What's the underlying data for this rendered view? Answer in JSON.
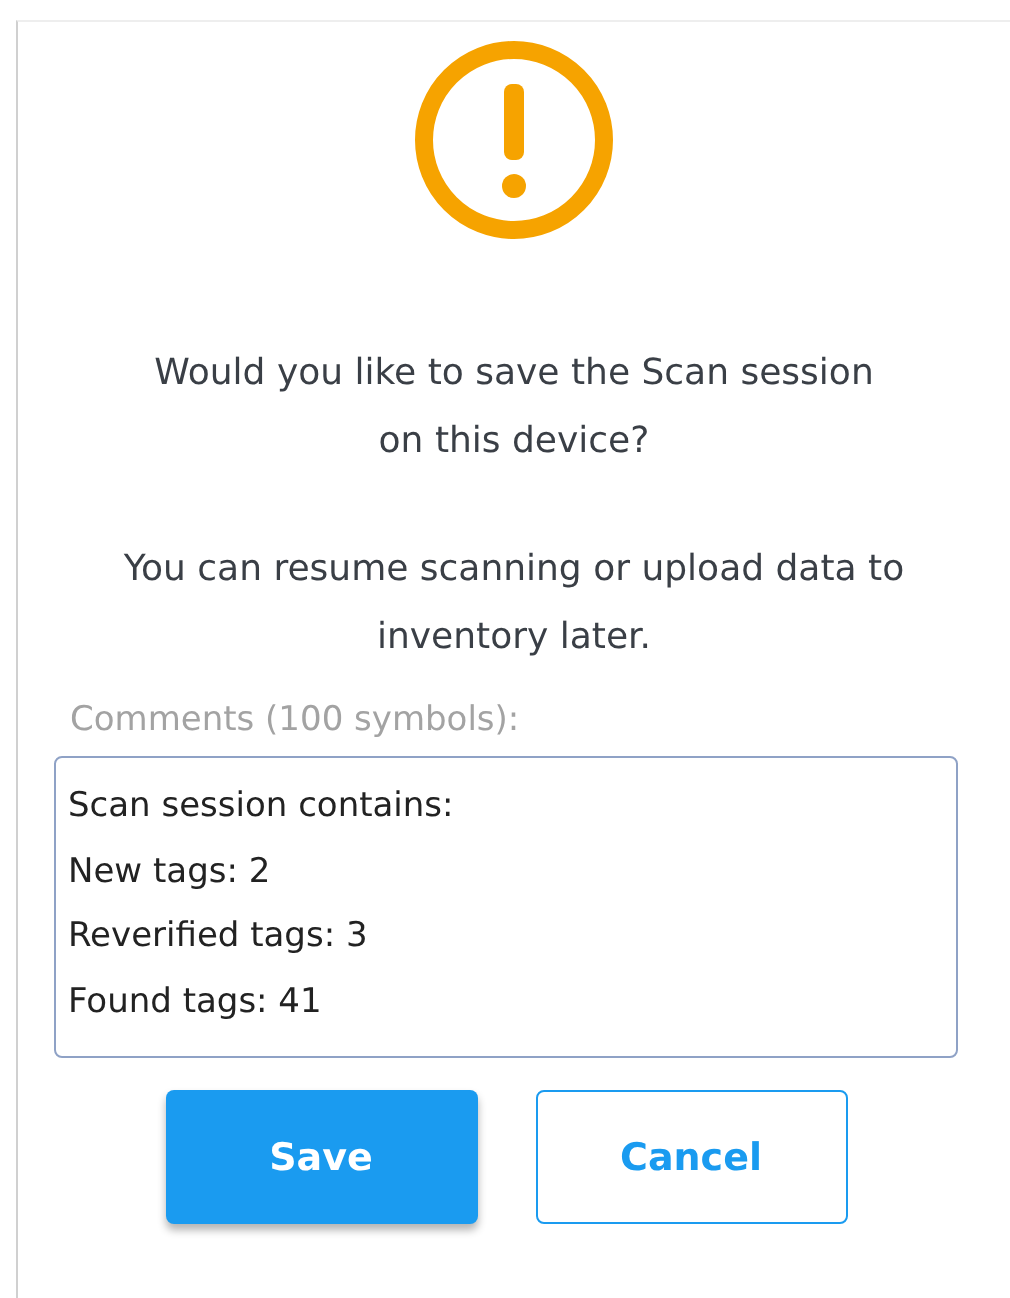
{
  "dialog": {
    "message": "Would you like to save the Scan session on this device?",
    "note": "You can resume scanning or upload data to inventory later.",
    "comments": {
      "label": "Comments (100 symbols):",
      "value": "Scan session contains:\nNew tags: 2\nReverified tags: 3\nFound tags: 41"
    },
    "buttons": [
      {
        "label": "Save",
        "kind": "primary"
      },
      {
        "label": "Cancel",
        "kind": "secondary"
      }
    ]
  }
}
